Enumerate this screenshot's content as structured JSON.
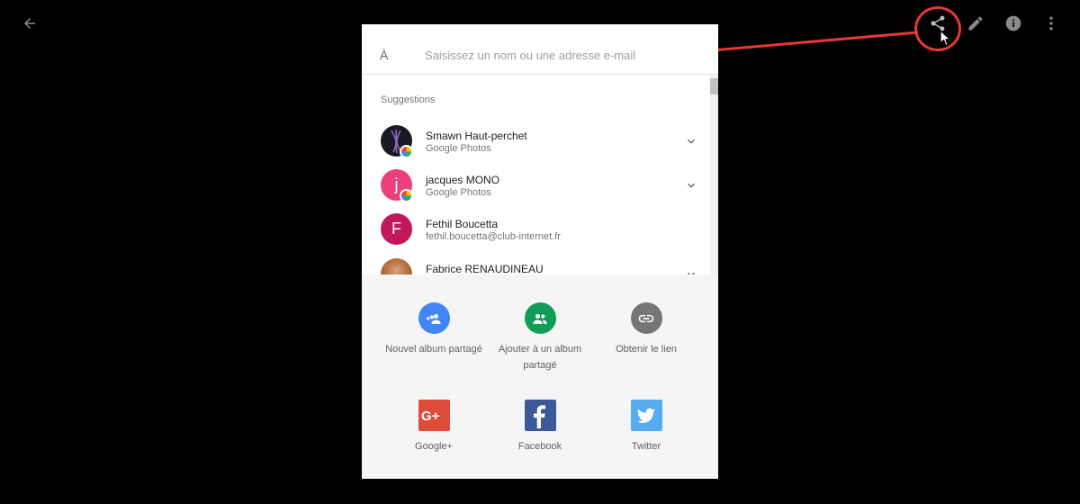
{
  "toolbar": {
    "back_icon": "arrow-back-icon",
    "share_icon": "share-icon",
    "edit_icon": "pencil-icon",
    "info_icon": "info-icon",
    "more_icon": "more-vertical-icon"
  },
  "share_dialog": {
    "to_label": "À",
    "to_placeholder": "Saisissez un nom ou une adresse e-mail",
    "suggestions_header": "Suggestions",
    "contacts": [
      {
        "name": "Smawn Haut-perchet",
        "sub": "Google Photos"
      },
      {
        "name": "jacques MONO",
        "sub": "Google Photos",
        "initial": "j"
      },
      {
        "name": "Fethil Boucetta",
        "sub": "fethil.boucetta@club-internet.fr",
        "initial": "F"
      },
      {
        "name": "Fabrice RENAUDINEAU",
        "sub": ""
      }
    ],
    "actions": [
      {
        "label": "Nouvel album partagé",
        "color": "#4285f4",
        "icon": "add-people-icon"
      },
      {
        "label": "Ajouter à un album partagé",
        "color": "#0f9d58",
        "icon": "people-icon"
      },
      {
        "label": "Obtenir le lien",
        "color": "#757575",
        "icon": "link-icon"
      },
      {
        "label": "Google+",
        "color": "#dd4b39",
        "icon": "google-plus-icon"
      },
      {
        "label": "Facebook",
        "color": "#3b5998",
        "icon": "facebook-icon"
      },
      {
        "label": "Twitter",
        "color": "#55acee",
        "icon": "twitter-icon"
      }
    ]
  },
  "colors": {
    "annotation_red": "#e53935",
    "avatar_jacques": "#ec407a",
    "avatar_fethil": "#c2185b"
  }
}
